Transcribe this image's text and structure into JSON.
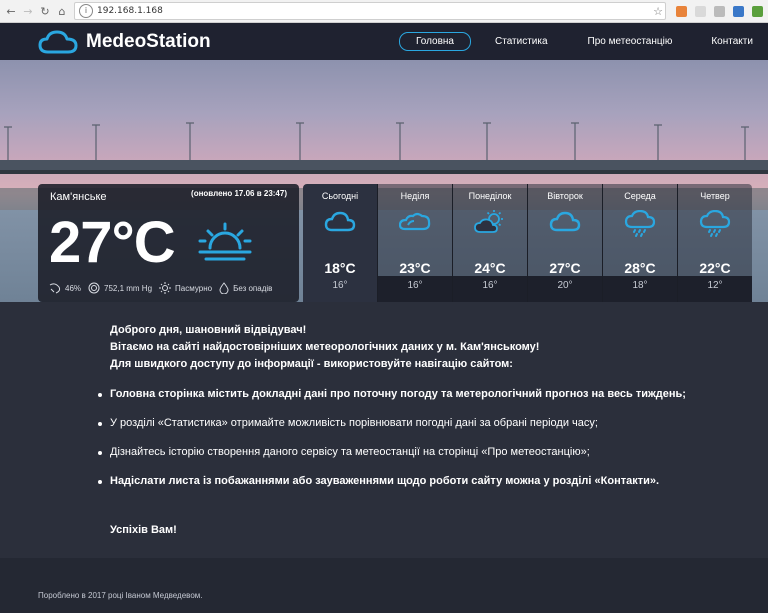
{
  "browser": {
    "url": "192.168.1.168",
    "back_icon": "arrow-left-icon",
    "forward_icon": "arrow-right-icon",
    "reload_icon": "reload-icon",
    "home_icon": "home-icon"
  },
  "site": {
    "logo_text": "MedeoStation",
    "accent": "#2aa7e0",
    "nav": [
      {
        "label": "Головна",
        "active": true
      },
      {
        "label": "Статистика"
      },
      {
        "label": "Про метеостанцію"
      },
      {
        "label": "Контакти"
      }
    ]
  },
  "current": {
    "city": "Кам'янське",
    "updated": "(оновлено 17.06 в 23:47)",
    "temperature": "27°C",
    "humidity": "46%",
    "pressure": "752,1 mm Hg",
    "condition": "Пасмурно",
    "precipitation": "Без опадів"
  },
  "forecast": [
    {
      "day": "Сьогодні",
      "icon": "cloud-icon",
      "high": "18°C",
      "low": "16°"
    },
    {
      "day": "Неділя",
      "icon": "cloud-icon",
      "high": "23°C",
      "low": "16°"
    },
    {
      "day": "Понеділок",
      "icon": "partly-cloudy-icon",
      "high": "24°C",
      "low": "16°"
    },
    {
      "day": "Вівторок",
      "icon": "cloud-icon",
      "high": "27°C",
      "low": "20°"
    },
    {
      "day": "Середа",
      "icon": "rain-icon",
      "high": "28°C",
      "low": "18°"
    },
    {
      "day": "Четвер",
      "icon": "rain-icon",
      "high": "22°C",
      "low": "12°"
    }
  ],
  "welcome": {
    "line1": "Доброго дня, шановний відвідувач!",
    "line2": "Вітаємо на сайті найдостовірніших метеорологічних даних у м. Кам'янському!",
    "line3": "Для швидкого доступу до інформації - використовуйте навігацію сайтом:",
    "bullets": [
      "Головна сторінка містить докладні дані про поточну погоду та метерологічний прогноз на весь тиждень;",
      "У розділі «Статистика» отримайте можливість порівнювати погодні дані за обрані періоди часу;",
      "Дізнайтесь історію створення даного сервісу та метеостанції на сторінці «Про метеостанцію»;",
      "Надіслати листа із побажаннями або зауваженнями щодо роботи сайту можна у розділі «Контакти»."
    ],
    "closing": "Успіхів Вам!"
  },
  "footer": {
    "text": "Пороблено в 2017 році Іваном Медведевом."
  }
}
